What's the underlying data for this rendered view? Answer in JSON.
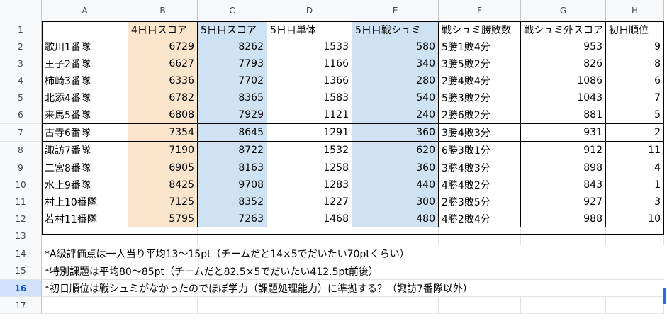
{
  "columns": [
    "A",
    "B",
    "C",
    "D",
    "E",
    "F",
    "G",
    "H"
  ],
  "rows": [
    "1",
    "2",
    "3",
    "4",
    "5",
    "6",
    "7",
    "8",
    "9",
    "10",
    "11",
    "12",
    "13",
    "14",
    "15",
    "16",
    "17"
  ],
  "active_row": "16",
  "header": [
    "",
    "4日目スコア",
    "5日目スコア",
    "5日目単体",
    "5日目戦シュミ",
    "戦シュミ勝敗数",
    "戦シュミ外スコア",
    "初日順位"
  ],
  "table": [
    [
      "歌川1番隊",
      "6729",
      "8262",
      "1533",
      "580",
      "5勝1敗4分",
      "953",
      "9"
    ],
    [
      "王子2番隊",
      "6627",
      "7793",
      "1166",
      "340",
      "3勝5敗2分",
      "826",
      "8"
    ],
    [
      "柿崎3番隊",
      "6336",
      "7702",
      "1366",
      "280",
      "2勝4敗4分",
      "1086",
      "6"
    ],
    [
      "北添4番隊",
      "6782",
      "8365",
      "1583",
      "540",
      "5勝3敗2分",
      "1043",
      "7"
    ],
    [
      "来馬5番隊",
      "6808",
      "7929",
      "1121",
      "240",
      "2勝6敗2分",
      "881",
      "5"
    ],
    [
      "古寺6番隊",
      "7354",
      "8645",
      "1291",
      "360",
      "3勝4敗3分",
      "931",
      "2"
    ],
    [
      "諏訪7番隊",
      "7190",
      "8722",
      "1532",
      "620",
      "6勝3敗1分",
      "912",
      "11"
    ],
    [
      "二宮8番隊",
      "6905",
      "8163",
      "1258",
      "360",
      "3勝4敗3分",
      "898",
      "4"
    ],
    [
      "水上9番隊",
      "8425",
      "9708",
      "1283",
      "440",
      "4勝4敗2分",
      "843",
      "1"
    ],
    [
      "村上10番隊",
      "7125",
      "8352",
      "1227",
      "300",
      "2勝3敗5分",
      "927",
      "3"
    ],
    [
      "若村11番隊",
      "5795",
      "7263",
      "1468",
      "480",
      "4勝2敗4分",
      "988",
      "10"
    ]
  ],
  "notes": [
    "*A級評価点は一人当り平均13～15pt（チームだと14×5でだいたい70ptくらい）",
    "*特別課題は平均80～85pt（チームだと82.5×5でだいたい412.5pt前後）",
    "*初日順位は戦シュミがなかったのでほぼ学力（課題処理能力）に準拠する？（諏訪7番隊以外）"
  ],
  "colors": {
    "orange_fill": "#fce5cd",
    "blue_fill": "#cfe2f3",
    "header_bg": "#f8f9fa",
    "active_row_bg": "#d3e3fd",
    "active_row_text": "#0b57d0"
  }
}
